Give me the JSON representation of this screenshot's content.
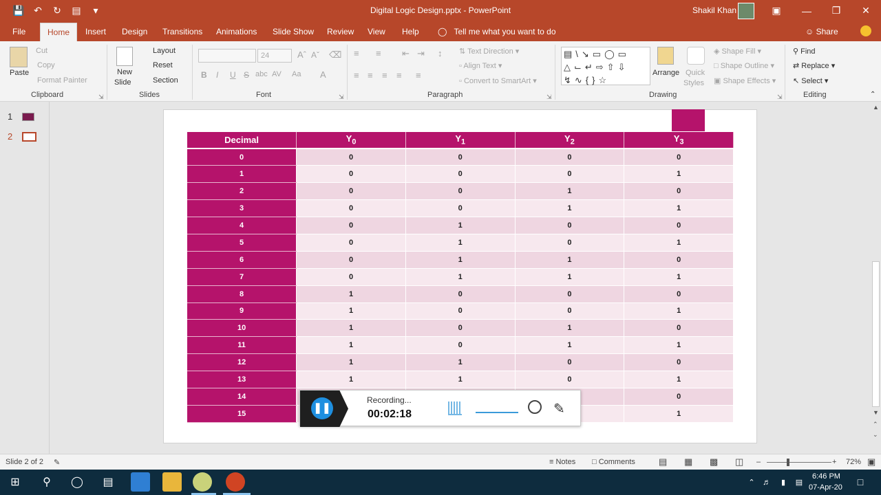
{
  "titlebar": {
    "title": "Digital Logic Design.pptx  -  PowerPoint",
    "user": "Shakil Khan"
  },
  "tabs": [
    "File",
    "Home",
    "Insert",
    "Design",
    "Transitions",
    "Animations",
    "Slide Show",
    "Review",
    "View",
    "Help"
  ],
  "active_tab": "Home",
  "tell_me": "Tell me what you want to do",
  "share": "Share",
  "ribbon": {
    "clipboard": {
      "label": "Clipboard",
      "paste": "Paste",
      "cut": "Cut",
      "copy": "Copy",
      "format_painter": "Format Painter"
    },
    "slides": {
      "label": "Slides",
      "new_slide": "New",
      "new_slide2": "Slide",
      "layout": "Layout",
      "reset": "Reset",
      "section": "Section"
    },
    "font": {
      "label": "Font",
      "size": "24"
    },
    "paragraph": {
      "label": "Paragraph",
      "text_direction": "Text Direction",
      "align_text": "Align Text",
      "convert_smartart": "Convert to SmartArt"
    },
    "drawing": {
      "label": "Drawing",
      "arrange": "Arrange",
      "quick": "Quick",
      "styles": "Styles",
      "shape_fill": "Shape Fill",
      "shape_outline": "Shape Outline",
      "shape_effects": "Shape Effects"
    },
    "editing": {
      "label": "Editing",
      "find": "Find",
      "replace": "Replace",
      "select": "Select"
    }
  },
  "slide_pane": {
    "slides": [
      "1",
      "2"
    ]
  },
  "table": {
    "headers": [
      "Decimal",
      "Y0",
      "Y1",
      "Y2",
      "Y3"
    ],
    "subscripts": [
      "0",
      "1",
      "2",
      "3"
    ],
    "rows": [
      [
        "0",
        "0",
        "0",
        "0",
        "0"
      ],
      [
        "1",
        "0",
        "0",
        "0",
        "1"
      ],
      [
        "2",
        "0",
        "0",
        "1",
        "0"
      ],
      [
        "3",
        "0",
        "0",
        "1",
        "1"
      ],
      [
        "4",
        "0",
        "1",
        "0",
        "0"
      ],
      [
        "5",
        "0",
        "1",
        "0",
        "1"
      ],
      [
        "6",
        "0",
        "1",
        "1",
        "0"
      ],
      [
        "7",
        "0",
        "1",
        "1",
        "1"
      ],
      [
        "8",
        "1",
        "0",
        "0",
        "0"
      ],
      [
        "9",
        "1",
        "0",
        "0",
        "1"
      ],
      [
        "10",
        "1",
        "0",
        "1",
        "0"
      ],
      [
        "11",
        "1",
        "0",
        "1",
        "1"
      ],
      [
        "12",
        "1",
        "1",
        "0",
        "0"
      ],
      [
        "13",
        "1",
        "1",
        "0",
        "1"
      ],
      [
        "14",
        "",
        "",
        "",
        "0"
      ],
      [
        "15",
        "",
        "",
        "",
        "1"
      ]
    ]
  },
  "recorder": {
    "status": "Recording...",
    "time": "00:02:18"
  },
  "statusbar": {
    "slide_info": "Slide 2 of 2",
    "notes": "Notes",
    "comments": "Comments",
    "zoom": "72%"
  },
  "taskbar": {
    "time": "6:46 PM",
    "date": "07-Apr-20"
  },
  "colors": {
    "accent": "#b7472a",
    "table_header": "#b5136b",
    "row_dark": "#efd6e1",
    "row_light": "#f7e8ee"
  }
}
